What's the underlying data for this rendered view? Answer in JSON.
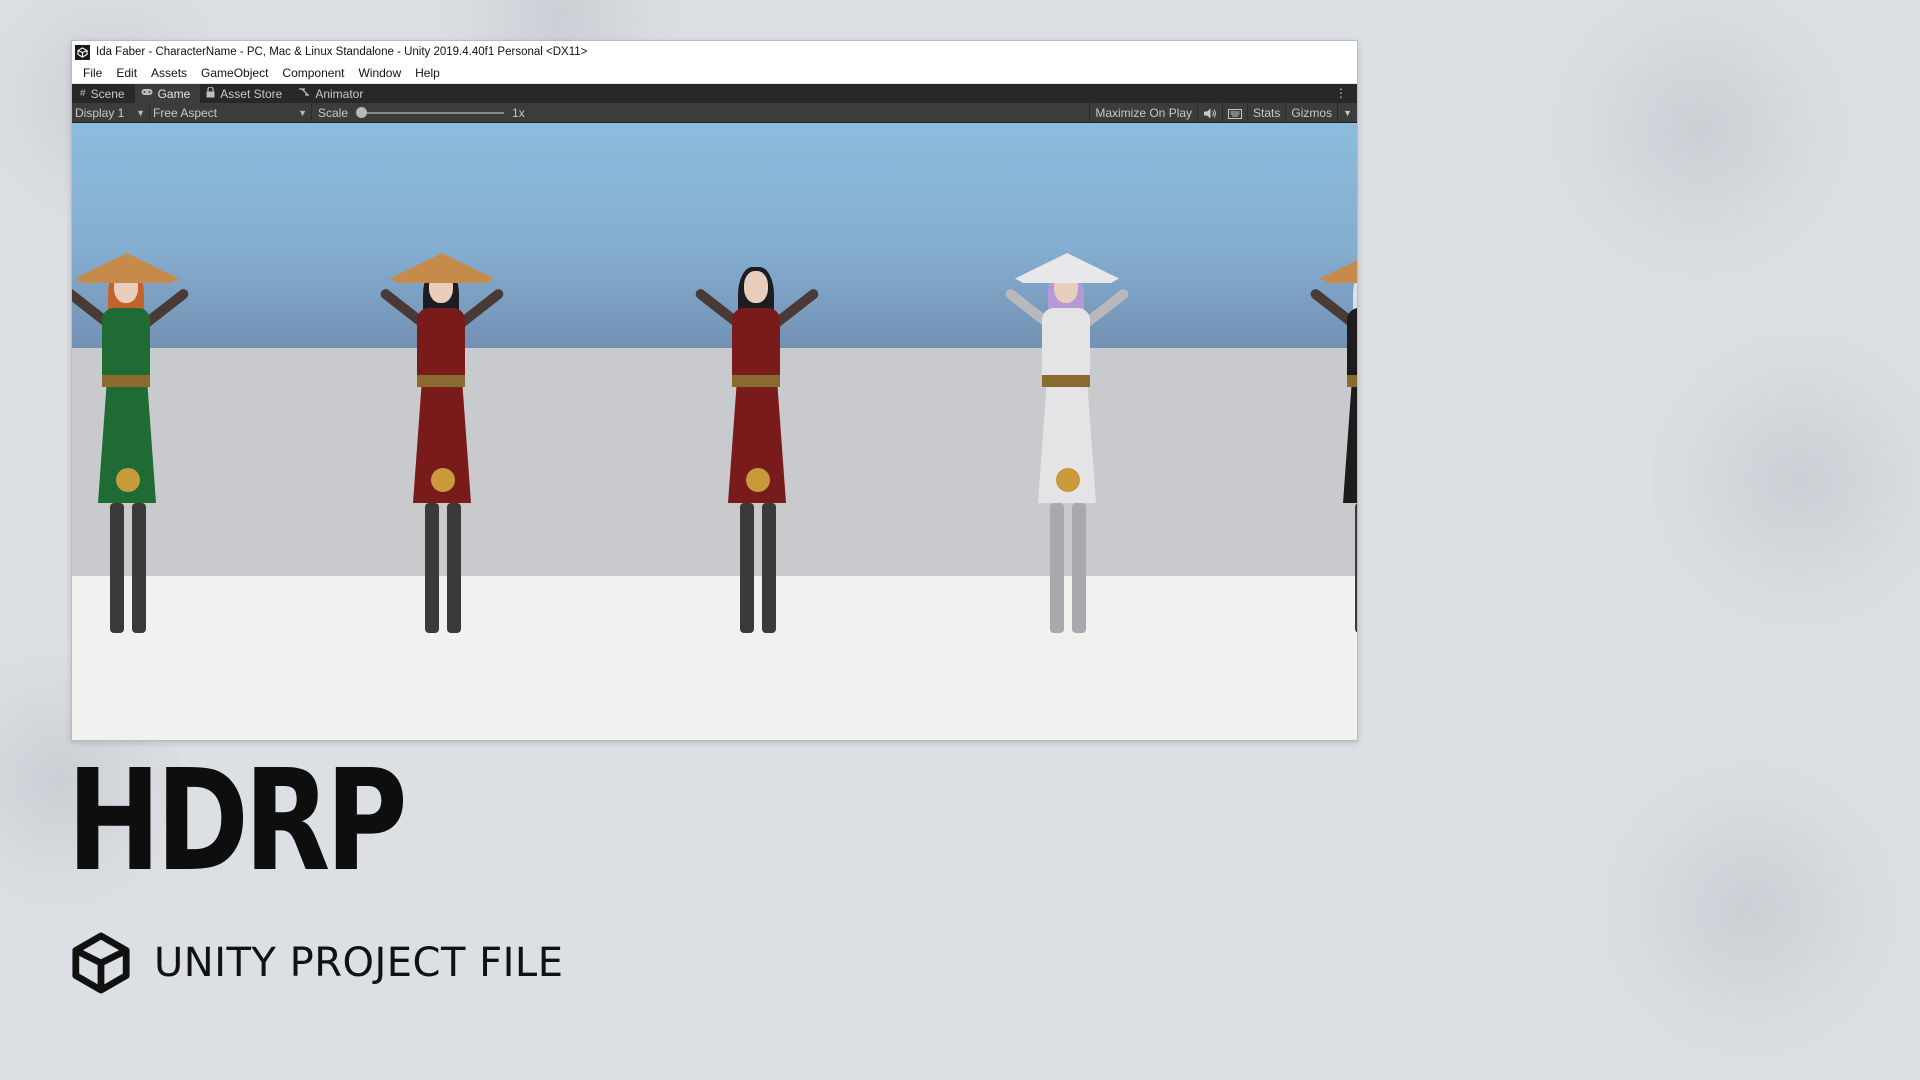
{
  "window": {
    "title": "Ida Faber - CharacterName - PC, Mac & Linux Standalone - Unity 2019.4.40f1 Personal <DX11>"
  },
  "menu": [
    "File",
    "Edit",
    "Assets",
    "GameObject",
    "Component",
    "Window",
    "Help"
  ],
  "tabs": [
    {
      "label": "Scene",
      "icon": "grid-icon"
    },
    {
      "label": "Game",
      "icon": "gamepad-icon"
    },
    {
      "label": "Asset Store",
      "icon": "lock-icon"
    },
    {
      "label": "Animator",
      "icon": "animator-icon"
    }
  ],
  "toolbar": {
    "display": "Display 1",
    "aspect": "Free Aspect",
    "scale_label": "Scale",
    "scale_value": "1x",
    "scale_fraction": 0.0,
    "maximize": "Maximize On Play",
    "stats": "Stats",
    "gizmos": "Gizmos"
  },
  "characters": [
    {
      "outfit": "green",
      "hat": "straw"
    },
    {
      "outfit": "red",
      "hat": "straw"
    },
    {
      "outfit": "red",
      "hat": "none"
    },
    {
      "outfit": "white",
      "hat": "white"
    },
    {
      "outfit": "black",
      "hat": "straw"
    }
  ],
  "branding": {
    "title": "HDRP",
    "subtitle": "UNITY PROJECT FILE"
  },
  "colors": {
    "green": "#1f6b34",
    "red": "#7a1b1b",
    "white": "#e4e4e6",
    "black": "#1c1c1c",
    "straw": "#c68b4a",
    "hat_white": "#e8e8ea"
  }
}
